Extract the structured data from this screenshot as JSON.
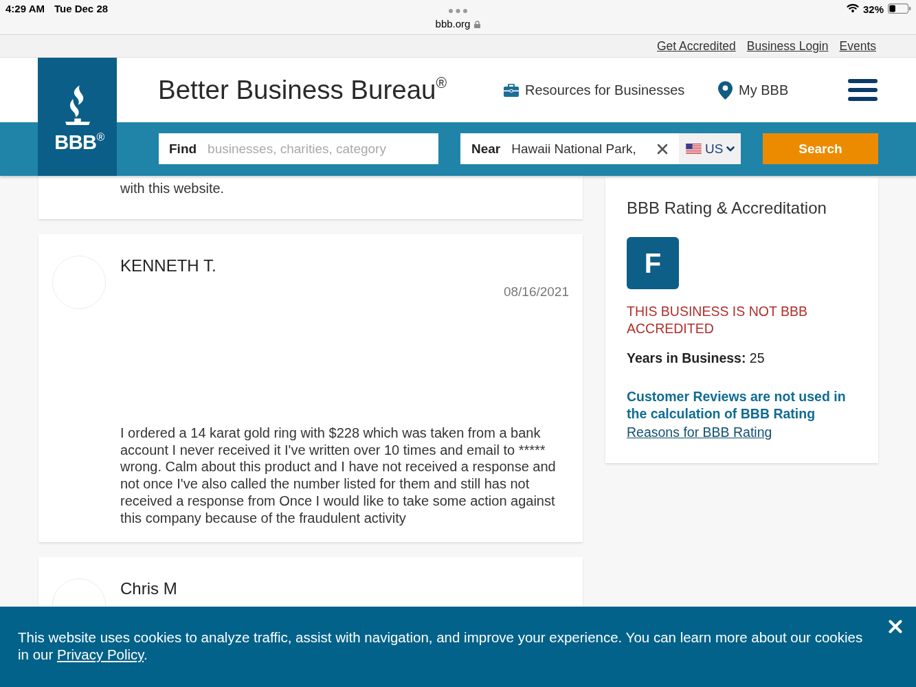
{
  "status_bar": {
    "time": "4:29 AM",
    "date": "Tue Dec 28",
    "url": "bbb.org",
    "battery": "32%"
  },
  "top_links": [
    "Get Accredited",
    "Business Login",
    "Events"
  ],
  "header": {
    "logo": "BBB$^{®}$",
    "title": "Better Business Bureau$^{®}$",
    "nav": [
      "Resources for Businesses",
      "My BBB"
    ]
  },
  "search": {
    "find_label": "Find",
    "find_placeholder": "businesses, charities, category",
    "near_label": "Near",
    "near_value": "Hawaii National Park,",
    "country": "US",
    "button": "Search"
  },
  "reviews": [
    {
      "text": "with this website."
    },
    {
      "name": "KENNETH T.",
      "date": "08/16/2021",
      "text": "I ordered a 14 karat gold ring with $228 which was taken from a bank account I never received it I've written over 10 times and email to ***** wrong. Calm about this product and I have not received a response and not once I've also called the number listed for them and still has not received a response from Once I would like to take some action against this company because of the fraudulent activity"
    },
    {
      "name": "Chris M"
    }
  ],
  "rating": {
    "title": "BBB Rating & Accreditation",
    "grade": "F",
    "status": "THIS BUSINESS IS NOT BBB ACCREDITED",
    "years": "**Years in Business:** 25",
    "note": "Customer Reviews are not used in the calculation of BBB Rating",
    "link": "Reasons for BBB Rating"
  },
  "cookie_banner": {
    "text": "This website uses cookies to analyze traffic, assist with navigation, and improve your experience. You can learn more about our cookies in our ",
    "link": "Privacy Policy",
    "end": "."
  }
}
